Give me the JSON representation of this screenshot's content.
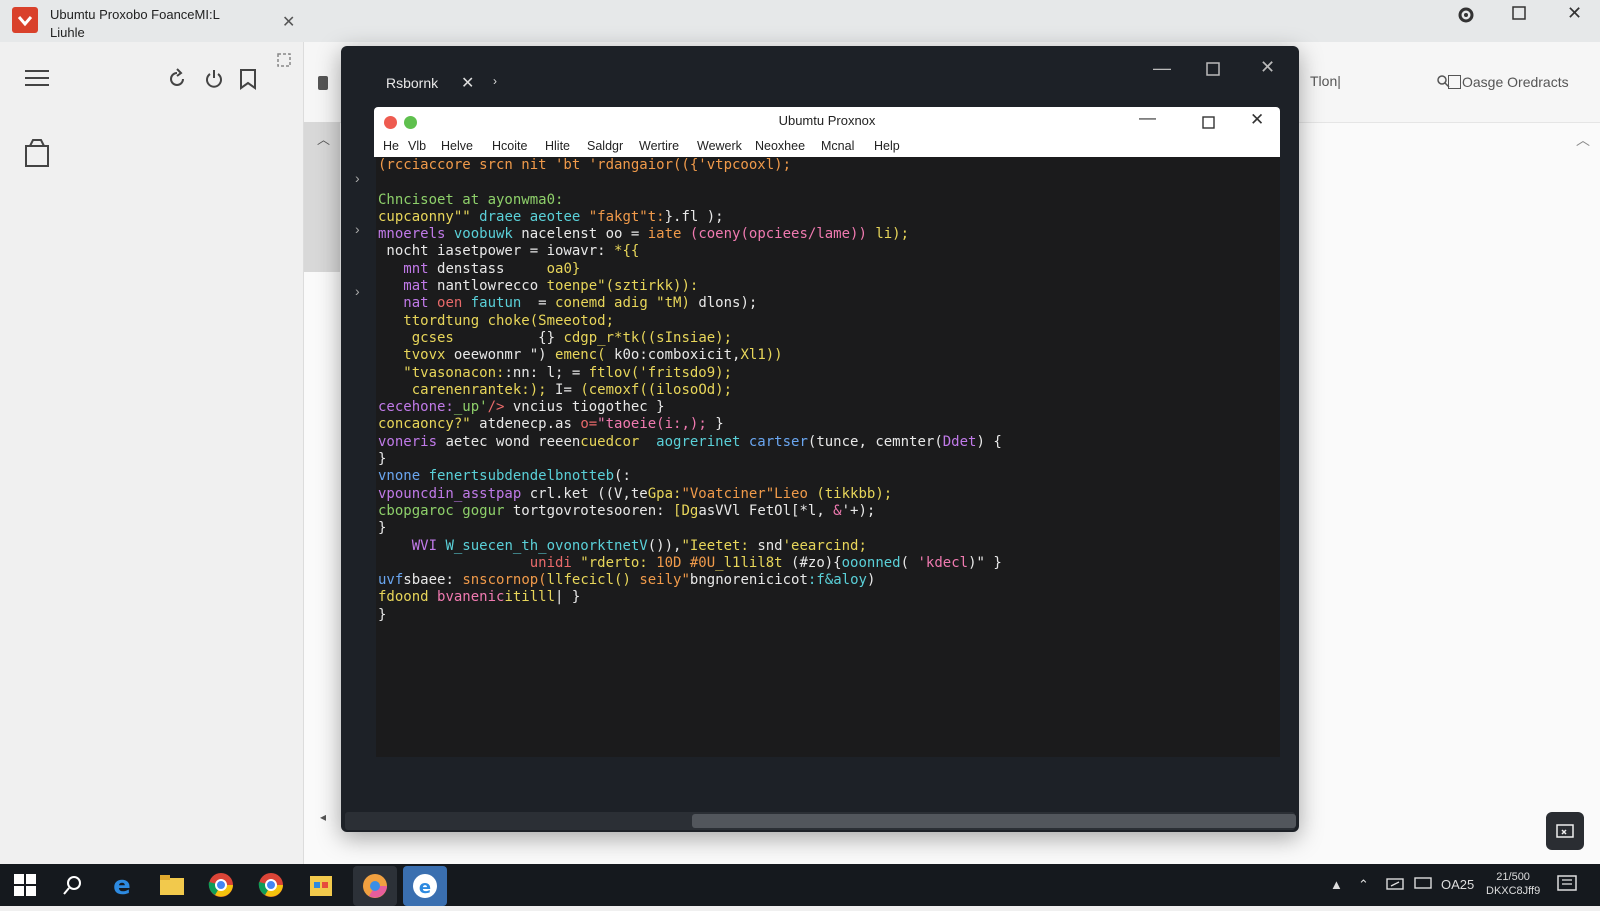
{
  "app": {
    "title_line1": "Ubumtu Proxobo FoanceMI:L",
    "title_line2": "Liuhle",
    "close_icon": "close-icon",
    "window_controls": [
      "gear-icon",
      "maximize-icon",
      "close-icon"
    ]
  },
  "left_panel": {
    "icons": [
      "menu-icon",
      "refresh-icon",
      "power-icon",
      "bookmark-icon",
      "selection-icon",
      "box-icon"
    ]
  },
  "vm": {
    "tab_label": "Rsbornk",
    "tab_close": "✕",
    "tab_arrow": "›"
  },
  "terminal": {
    "title": "Ubumtu Proxnox",
    "menu": [
      "He",
      "Vlb",
      "Helve",
      "Hcoite",
      "Hlite",
      "Saldgr",
      "Wertire",
      "Wewerk",
      "Neoxhee",
      "Mcnal",
      "Help"
    ]
  },
  "right_toolbar": {
    "input_text": "Tlon|",
    "search_label": "Oasge Oredracts"
  },
  "code_lines": [
    [
      [
        "c-orange",
        "(rcciaccore srcn nit 'bt 'rdangaior(({'vtpcooxl);"
      ]
    ],
    [
      [
        "c-white",
        ""
      ]
    ],
    [
      [
        "c-green",
        "Chncisoet at ayonwma0:"
      ]
    ],
    [
      [
        "c-yellow",
        "cupcaonny\"\" "
      ],
      [
        "c-cyan",
        "draee aeotee "
      ],
      [
        "c-orange",
        "\"fakgt\"t:"
      ],
      [
        "c-white",
        "}.fl );"
      ]
    ],
    [
      [
        "c-purple",
        "mnoerels "
      ],
      [
        "c-cyan",
        "voobuwk "
      ],
      [
        "c-white",
        "nacelenst oo = "
      ],
      [
        "c-orange",
        "iate "
      ],
      [
        "c-pink",
        "(coeny(opciees/lame)) "
      ],
      [
        "c-yellow",
        "li);"
      ]
    ],
    [
      [
        "c-white",
        " nocht iasetpower = iowavr: "
      ],
      [
        "c-yellow",
        "*{{"
      ]
    ],
    [
      [
        "c-purple",
        "   mnt "
      ],
      [
        "c-white",
        "denstass     "
      ],
      [
        "c-yellow",
        "oa0}"
      ]
    ],
    [
      [
        "c-purple",
        "   mat "
      ],
      [
        "c-white",
        "nantlowrecco "
      ],
      [
        "c-yellow",
        "toenpe\"(sztirkk)):"
      ]
    ],
    [
      [
        "c-purple",
        "   nat "
      ],
      [
        "c-red",
        "oen "
      ],
      [
        "c-cyan",
        "fautun  "
      ],
      [
        "c-white",
        "= "
      ],
      [
        "c-yellow",
        "conemd adig \"tM) "
      ],
      [
        "c-white",
        "dlons);"
      ]
    ],
    [
      [
        "c-yellow",
        "   ttordtung choke(Smeeotod;"
      ]
    ],
    [
      [
        "c-yellow",
        "    gcses          "
      ],
      [
        "c-white",
        "{} "
      ],
      [
        "c-yellow",
        "cdgp_r*tk((sInsiae);"
      ]
    ],
    [
      [
        "c-yellow",
        "   tvovx "
      ],
      [
        "c-white",
        "oeewonmr \") "
      ],
      [
        "c-yellow",
        "emenc( "
      ],
      [
        "c-white",
        "k0o:comboxicit,"
      ],
      [
        "c-yellow",
        "Xl1))"
      ]
    ],
    [
      [
        "c-yellow",
        "   \"tvasonacon:"
      ],
      [
        "c-white",
        ":nn: l; = "
      ],
      [
        "c-yellow",
        "ftlov('fritsdo9);"
      ]
    ],
    [
      [
        "c-yellow",
        "    carenenrantek:); "
      ],
      [
        "c-white",
        "I= "
      ],
      [
        "c-yellow",
        "(cemoxf((ilosoOd);"
      ]
    ],
    [
      [
        "c-purple",
        "cecehone:"
      ],
      [
        "c-green",
        "_up'"
      ],
      [
        "c-red",
        "/> "
      ],
      [
        "c-white",
        "vncius tiogothec }"
      ]
    ],
    [
      [
        "c-yellow",
        "concaoncy?\" "
      ],
      [
        "c-white",
        "atdenecp.as "
      ],
      [
        "c-red",
        "o="
      ],
      [
        "c-pink",
        "\"taoeie(i:,); "
      ],
      [
        "c-white",
        "}"
      ]
    ],
    [
      [
        "c-purple",
        "voneris "
      ],
      [
        "c-white",
        "aetec wond reeen"
      ],
      [
        "c-yellow",
        "cuedcor  "
      ],
      [
        "c-cyan",
        "aogrerinet "
      ],
      [
        "c-blue",
        "cartser"
      ],
      [
        "c-white",
        "(tunce, cemnter("
      ],
      [
        "c-purple",
        "Ddet"
      ],
      [
        "c-white",
        ") {"
      ]
    ],
    [
      [
        "c-white",
        "}"
      ]
    ],
    [
      [
        "c-blue",
        "vnone "
      ],
      [
        "c-cyan",
        "fenertsubdendelbnotteb"
      ],
      [
        "c-white",
        "(:"
      ]
    ],
    [
      [
        "c-purple",
        "vpouncdin_asstpap "
      ],
      [
        "c-white",
        "crl.ket ((V,te"
      ],
      [
        "c-yellow",
        "Gpa:"
      ],
      [
        "c-orange",
        "\"Voatciner\"Lieo "
      ],
      [
        "c-yellow",
        "(tikkbb);"
      ]
    ],
    [
      [
        "c-green",
        "cbopgaroc gogur "
      ],
      [
        "c-white",
        "tortgovrotesooren: "
      ],
      [
        "c-yellow",
        "[Dg"
      ],
      [
        "c-white",
        "asVVl FetOl[*l, "
      ],
      [
        "c-pink",
        "&"
      ],
      [
        "c-white",
        "'+);"
      ]
    ],
    [
      [
        "c-white",
        "}"
      ]
    ],
    [
      [
        "c-purple",
        "    WVI "
      ],
      [
        "c-cyan",
        "W_suecen_th_ovonorktnetV"
      ],
      [
        "c-white",
        "()),"
      ],
      [
        "c-yellow",
        "\"Ieetet:"
      ],
      [
        "c-white",
        " snd"
      ],
      [
        "c-yellow",
        "'eearcind;"
      ]
    ],
    [
      [
        "c-white",
        "                  "
      ],
      [
        "c-red",
        "unidi "
      ],
      [
        "c-yellow",
        "\"rderto: "
      ],
      [
        "c-orange",
        "10D #0U"
      ],
      [
        "c-yellow",
        "_l1lil8t "
      ],
      [
        "c-white",
        "(#zo){"
      ],
      [
        "c-cyan",
        "ooonned"
      ],
      [
        "c-white",
        "( "
      ],
      [
        "c-pink",
        "'kdecl"
      ],
      [
        "c-white",
        ")\" }"
      ]
    ],
    [
      [
        "c-blue",
        "uvf"
      ],
      [
        "c-white",
        "sbaee: "
      ],
      [
        "c-orange",
        "snscornop("
      ],
      [
        "c-yellow",
        "llfecicl() "
      ],
      [
        "c-orange",
        "seily\""
      ],
      [
        "c-white",
        "bngnorenicicot"
      ],
      [
        "c-cyan",
        ":f&aloy"
      ],
      [
        "c-white",
        ")"
      ]
    ],
    [
      [
        "c-yellow",
        "fdoond "
      ],
      [
        "c-pink",
        "bvanenic"
      ],
      [
        "c-yellow",
        "itilll"
      ],
      [
        "c-white",
        "| }"
      ]
    ],
    [
      [
        "c-white",
        "}"
      ]
    ]
  ],
  "taskbar": {
    "clock_line1": "21/500",
    "clock_line2": "DKXC8Jff9",
    "tray_text": "OA25"
  }
}
